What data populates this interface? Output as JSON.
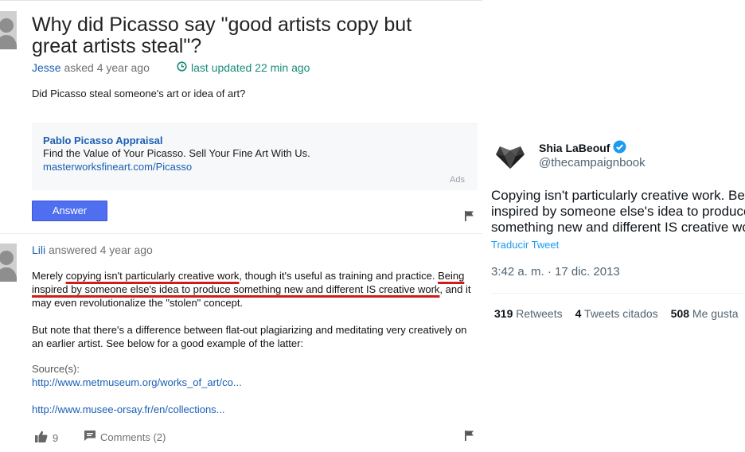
{
  "question": {
    "title": "Why did Picasso say \"good artists copy but great artists steal\"?",
    "author": "Jesse",
    "asked_text": "asked 4 year ago",
    "updated_text": "last updated 22 min ago",
    "body": "Did Picasso steal someone's art or idea of art?"
  },
  "ad": {
    "title": "Pablo Picasso Appraisal",
    "description": "Find the Value of Your Picasso. Sell Your Fine Art With Us.",
    "url": "masterworksfineart.com/Picasso",
    "label": "Ads"
  },
  "answer_button_label": "Answer",
  "answer": {
    "author": "Lili",
    "answered_text": "answered 4 year ago",
    "p1_before": "Merely ",
    "p1_underlined": "copying isn't particularly creative work",
    "p1_mid": ", though it's useful as training and practice. ",
    "p1_underlined2": "Being inspired by someone else's idea to produce something new and different IS creative work",
    "p1_after": ", and it may even revolutionalize the \"stolen\" concept.",
    "p2": "But note that there's a difference between flat-out plagiarizing and meditating very creatively on an earlier artist. See below for a good example of the latter:",
    "sources_label": "Source(s):",
    "source_links": [
      "http://www.metmuseum.org/works_of_art/co...",
      "http://www.musee-orsay.fr/en/collections..."
    ],
    "likes": "9",
    "comments_label": "Comments (2)"
  },
  "tweet": {
    "name": "Shia LaBeouf",
    "handle": "@thecampaignbook",
    "text_lines": [
      "Copying isn't particularly creative work. Being",
      "inspired by someone else's idea to produce",
      "something new and different IS creative work."
    ],
    "translate_label": "Traducir Tweet",
    "timestamp": "3:42 a. m. · 17 dic. 2013",
    "retweets_count": "319",
    "retweets_label": "Retweets",
    "quotes_count": "4",
    "quotes_label": "Tweets citados",
    "likes_count": "508",
    "likes_label": "Me gusta"
  },
  "colors": {
    "link_blue": "#1a5fb4",
    "updated_teal": "#188b7a",
    "underline_red": "#d21c1c",
    "button_blue": "#4f6ff0",
    "twitter_blue": "#1d9bf0"
  },
  "icons": [
    "user-avatar-icon",
    "clock-icon",
    "flag-icon",
    "thumbs-up-icon",
    "comment-icon",
    "verified-badge-icon"
  ]
}
